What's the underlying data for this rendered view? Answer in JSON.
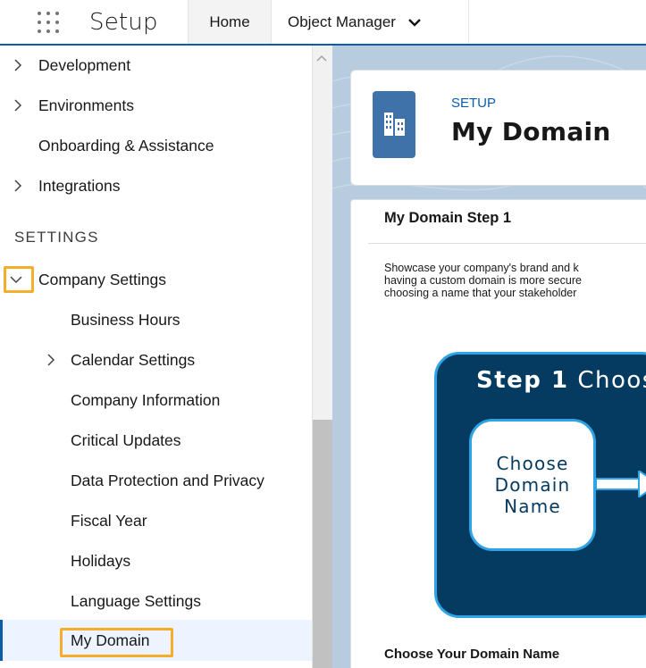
{
  "header": {
    "app_name": "Setup",
    "tabs": [
      {
        "label": "Home"
      },
      {
        "label": "Object Manager"
      }
    ]
  },
  "sidebar": {
    "items_top": [
      {
        "label": "Development",
        "has_chevron": true
      },
      {
        "label": "Environments",
        "has_chevron": true
      },
      {
        "label": "Onboarding & Assistance",
        "has_chevron": false
      },
      {
        "label": "Integrations",
        "has_chevron": true
      }
    ],
    "section_title": "SETTINGS",
    "company_settings": {
      "label": "Company Settings",
      "expanded": true,
      "children": [
        {
          "label": "Business Hours"
        },
        {
          "label": "Calendar Settings",
          "has_chevron": true
        },
        {
          "label": "Company Information"
        },
        {
          "label": "Critical Updates"
        },
        {
          "label": "Data Protection and Privacy"
        },
        {
          "label": "Fiscal Year"
        },
        {
          "label": "Holidays"
        },
        {
          "label": "Language Settings"
        },
        {
          "label": "My Domain",
          "active": true
        }
      ]
    }
  },
  "page_header": {
    "eyebrow": "SETUP",
    "title": "My Domain",
    "icon": "building-icon"
  },
  "content": {
    "step_title": "My Domain Step 1",
    "description_lines": [
      "Showcase your company's brand and k",
      "having a custom domain is more secure",
      "choosing a name that your stakeholder"
    ],
    "diagram": {
      "title_bold": "Step 1",
      "title_rest": "Choos",
      "box_lines": [
        "Choose",
        "Domain",
        "Name"
      ]
    },
    "section_label": "Choose Your Domain Name"
  },
  "colors": {
    "brand_blue": "#0b5cab",
    "highlight": "#f4ae2c",
    "diagram_bg": "#053b60",
    "diagram_border": "#2fa4e4",
    "icon_bg": "#3f72a8"
  }
}
